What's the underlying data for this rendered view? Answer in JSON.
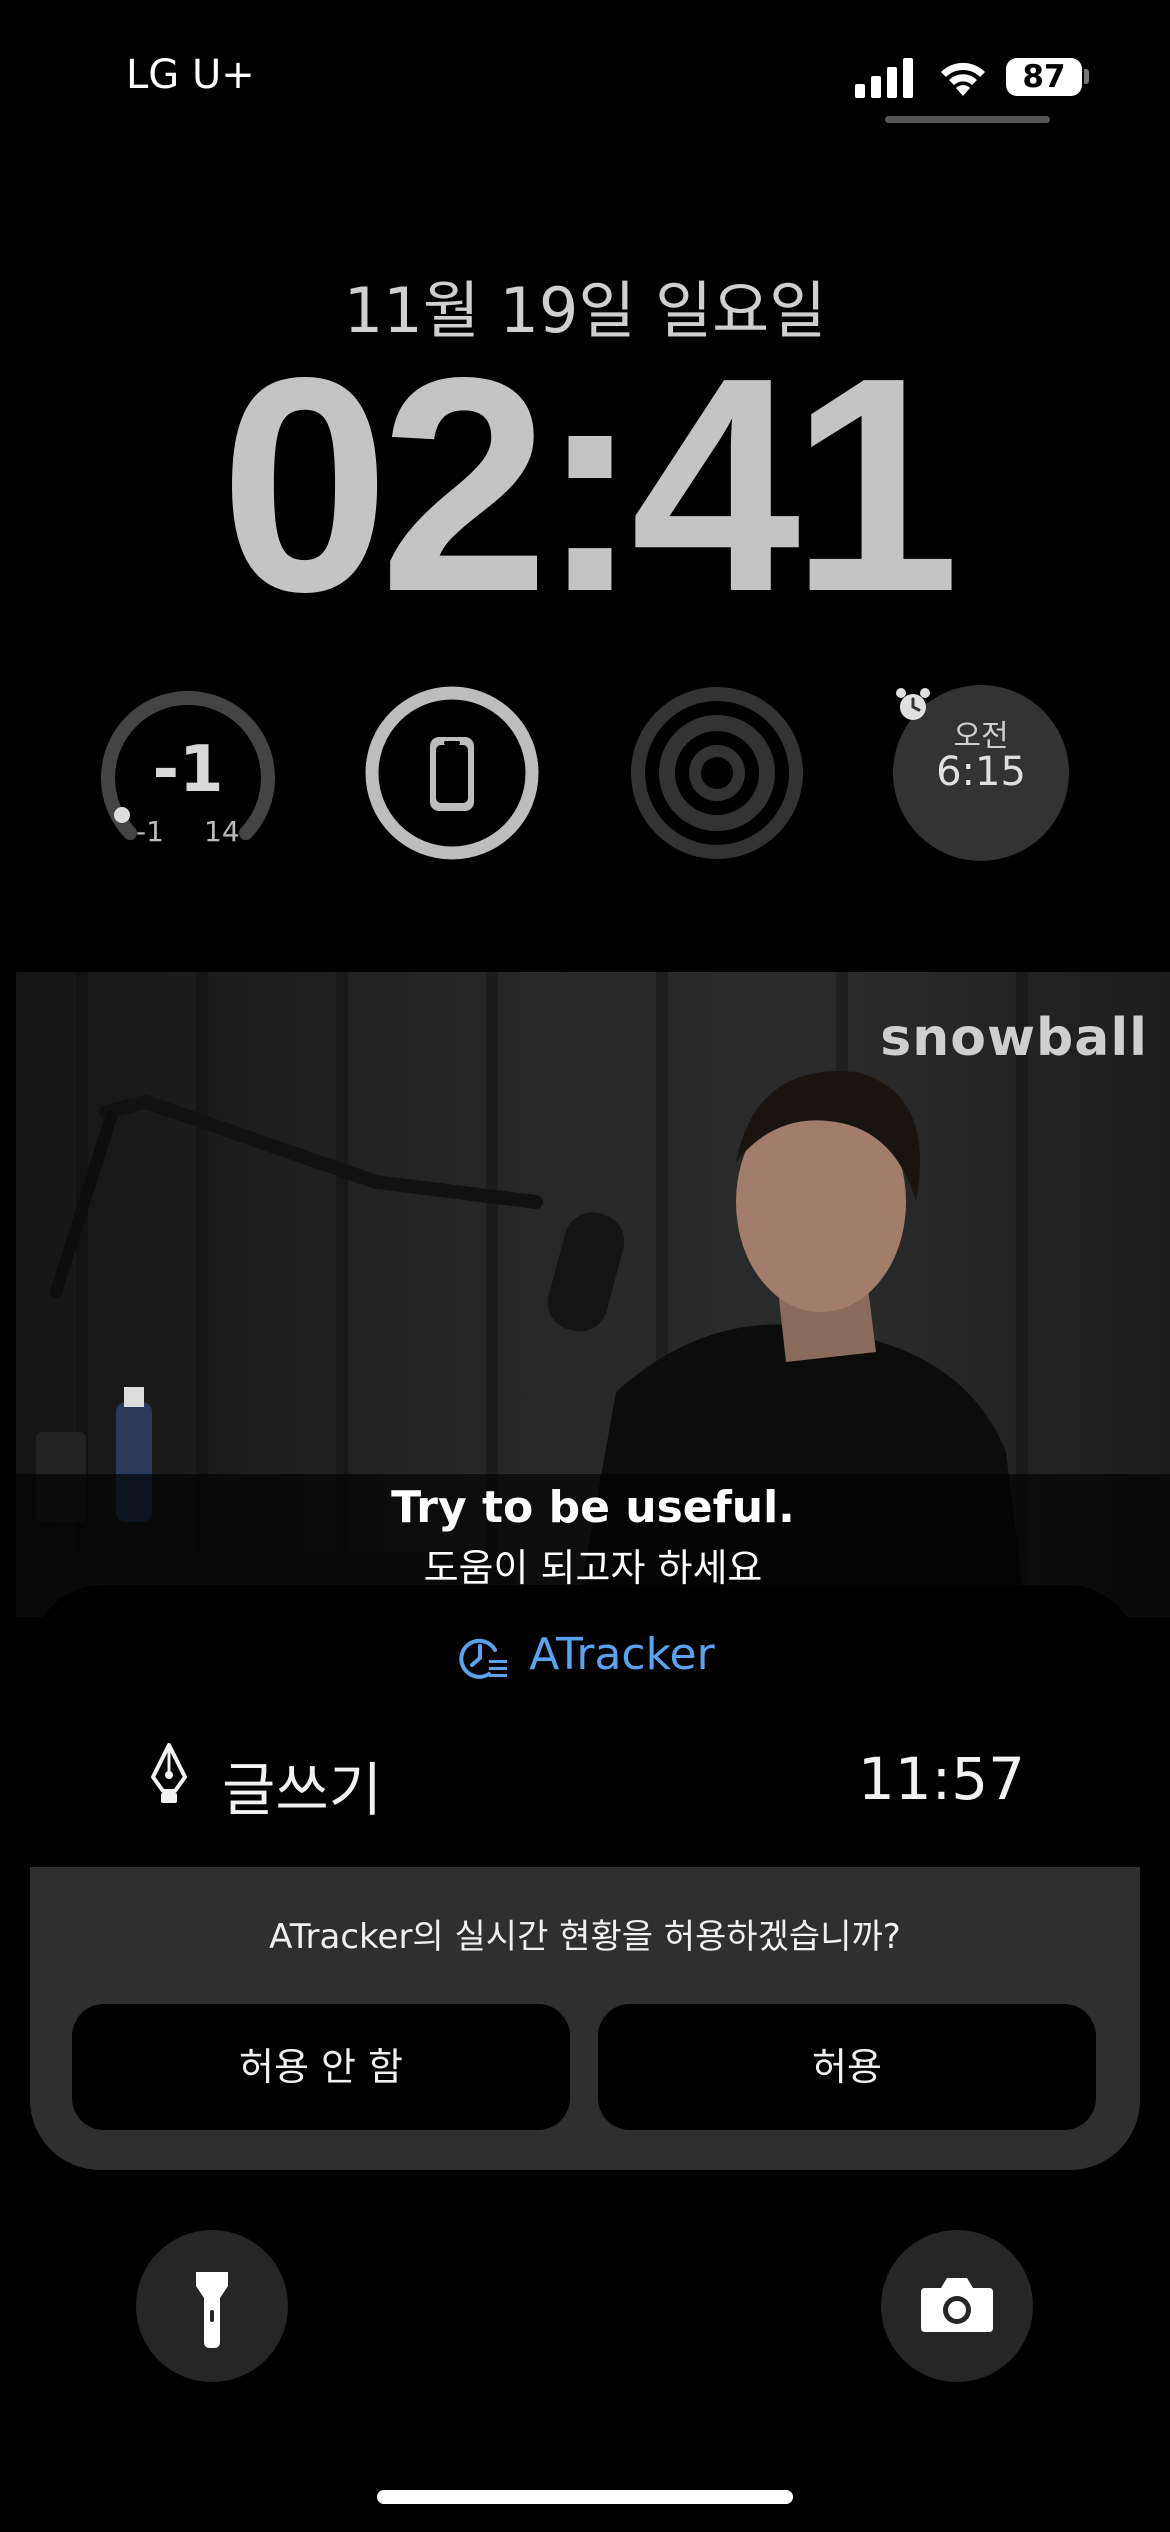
{
  "status_bar": {
    "carrier": "LG U+",
    "battery": "87",
    "signal_icon": "cellular-signal-icon",
    "wifi_icon": "wifi-icon"
  },
  "lock_screen": {
    "date": "11월 19일 일요일",
    "time": "02:41"
  },
  "widgets": {
    "temperature": {
      "current": "-1",
      "low": "-1",
      "high": "14"
    },
    "phone_battery": {
      "icon": "iphone-icon"
    },
    "focus": {
      "icon": "focus-rings-icon"
    },
    "alarm": {
      "period": "오전",
      "time": "6:15",
      "icon": "alarm-clock-icon"
    }
  },
  "wallpaper_video": {
    "watermark": "snowball",
    "subtitle_en": "Try to be useful.",
    "subtitle_ko": "도움이 되고자 하세요"
  },
  "live_activity": {
    "app_name": "ATracker",
    "app_icon": "atracker-clock-icon",
    "task_icon": "pen-nib-icon",
    "task_name": "글쓰기",
    "task_time": "11:57",
    "prompt": "ATracker의 실시간 현황을 허용하겠습니까?",
    "deny_label": "허용 안 함",
    "allow_label": "허용"
  },
  "bottom_controls": {
    "flashlight_icon": "flashlight-icon",
    "camera_icon": "camera-icon"
  },
  "colors": {
    "background": "#000000",
    "accent": "#5aa3f0",
    "prompt_bg": "#2f2f2f"
  }
}
